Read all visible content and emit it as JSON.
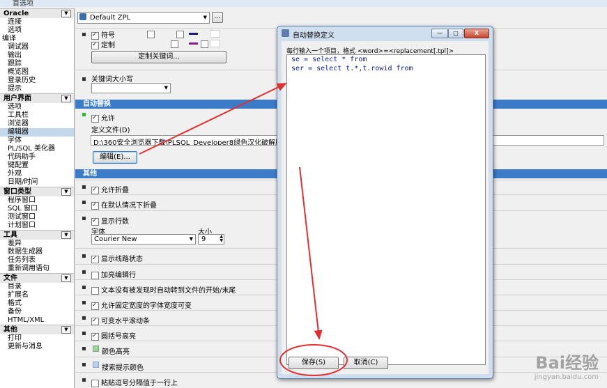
{
  "window": {
    "title": "首选项"
  },
  "sidebar": {
    "groups": [
      {
        "header": "Oracle",
        "items": [
          {
            "label": "连接"
          },
          {
            "label": "选项"
          },
          {
            "label": "编译",
            "flush": true
          },
          {
            "label": "调试器"
          },
          {
            "label": "输出"
          },
          {
            "label": "跟踪"
          },
          {
            "label": "概览图"
          },
          {
            "label": "登录历史"
          },
          {
            "label": "提示"
          }
        ]
      },
      {
        "header": "用户界面",
        "items": [
          {
            "label": "选项"
          },
          {
            "label": "工具栏"
          },
          {
            "label": "浏览器"
          },
          {
            "label": "编辑器",
            "selected": true
          },
          {
            "label": "字体"
          },
          {
            "label": "PL/SQL 美化器"
          },
          {
            "label": "代码助手"
          },
          {
            "label": "键配置"
          },
          {
            "label": "外观"
          },
          {
            "label": "日期/时间"
          }
        ]
      },
      {
        "header": "窗口类型",
        "items": [
          {
            "label": "程序窗口"
          },
          {
            "label": "SQL 窗口"
          },
          {
            "label": "测试窗口"
          },
          {
            "label": "计划窗口"
          }
        ]
      },
      {
        "header": "工具",
        "items": [
          {
            "label": "差异"
          },
          {
            "label": "数据生成器"
          },
          {
            "label": "任务列表"
          },
          {
            "label": "重新调用语句"
          }
        ]
      },
      {
        "header": "文件",
        "items": [
          {
            "label": "目录"
          },
          {
            "label": "扩展名"
          },
          {
            "label": "格式"
          },
          {
            "label": "备份"
          },
          {
            "label": "HTML/XML"
          }
        ]
      },
      {
        "header": "其他",
        "items": [
          {
            "label": "打印"
          },
          {
            "label": "更新与消息"
          }
        ]
      }
    ]
  },
  "main": {
    "profile": {
      "value": "Default ZPL",
      "more_label": "..."
    },
    "syntax": {
      "symbol_label": "符号",
      "custom_label": "定制",
      "define_keywords_button": "定制关键词..."
    },
    "keyword_case": {
      "label": "关键词大小写",
      "value": ""
    },
    "auto_replace": {
      "section_title": "自动替换",
      "enable_label": "允许",
      "file_label": "定义文件(D)",
      "file_path": "D:\\360安全浏览器下载\\PLSQL_Developer8绿色汉化破解版\\PLS",
      "edit_button": "编辑(E)..."
    },
    "other": {
      "section_title": "其他",
      "allow_folding": "允许折叠",
      "fold_default": "在默认情况下折叠",
      "show_line_numbers": "显示行数",
      "font_label": "字体",
      "font_value": "Courier New",
      "size_label": "大小",
      "size_value": "9",
      "show_gutter": "显示线路状态",
      "highlight_line": "加亮编辑行",
      "cursor_wrap": "文本没有被发现时自动转到文件的开始/末尾",
      "fixed_width": "允许固定宽度的字体宽度可变",
      "h_scroll": "可变水平滚动条",
      "bracket_highlight": "圆括号高亮",
      "color_highlight": "颜色高亮",
      "search_color": "搜索提示颜色",
      "paste_comma": "粘贴逗号分隔值于一行上"
    }
  },
  "dialog": {
    "title": "自动替换定义",
    "hint": "每行输入一个项目，格式 <word>=<replacement[.tpl]>",
    "lines": [
      "se = select * from",
      "ser = select t.*,t.rowid from"
    ],
    "save_button": "保存(S)",
    "cancel_button": "取消(C)",
    "minimize_glyph": "—",
    "maximize_glyph": "□",
    "close_glyph": "X"
  },
  "watermark": {
    "text": "Bai经验",
    "url": "jingyan.baidu.com"
  },
  "colors": {
    "accent": "#3b7bc8",
    "annotation": "#e03030",
    "dialog_frame": "#cfdff0"
  }
}
